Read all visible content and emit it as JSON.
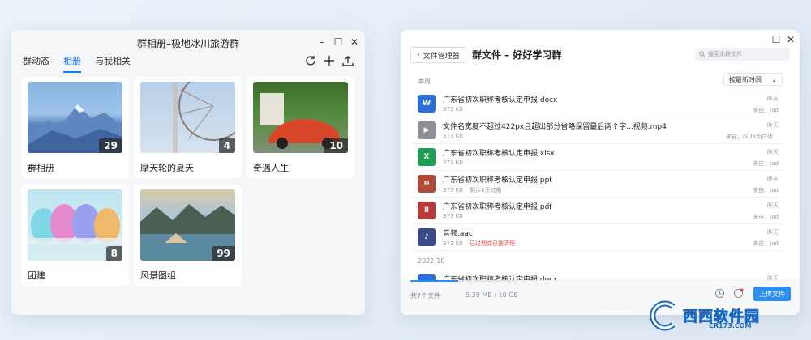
{
  "album_window": {
    "title": "群相册–极地冰川旅游群",
    "controls": {
      "minimize": "–",
      "maximize": "☐",
      "close": "✕"
    },
    "tabs": [
      {
        "label": "群动态",
        "active": false
      },
      {
        "label": "相册",
        "active": true
      },
      {
        "label": "与我相关",
        "active": false
      }
    ],
    "toolbar_icons": [
      "refresh-icon",
      "add-icon",
      "upload-icon"
    ],
    "albums": [
      {
        "name": "群相册",
        "count": "29"
      },
      {
        "name": "摩天轮的夏天",
        "count": "4"
      },
      {
        "name": "奇遇人生",
        "count": "10"
      },
      {
        "name": "团建",
        "count": "8"
      },
      {
        "name": "风景图组",
        "count": "99"
      }
    ]
  },
  "files_window": {
    "back_label": "文件管理器",
    "title": "群文件 – 好好学习群",
    "search_placeholder": "搜索本群文件",
    "controls": {
      "minimize": "–",
      "maximize": "☐",
      "close": "✕"
    },
    "section_this_week": "本周",
    "sort_label": "按最新时间",
    "section_older": "2022-10",
    "files": [
      {
        "icon": "W",
        "name": "广东省初次职称考核认定申报.docx",
        "size": "373 KB",
        "note": "",
        "date": "昨天",
        "sender": "来自：jad",
        "color": "#2b6fd6"
      },
      {
        "icon": "▶",
        "name": "文件名宽度不超过422px且超出部分省略保留最后两个字...视频.mp4",
        "size": "373 KB",
        "note": "",
        "date": "昨天",
        "sender": "来自：ISUX用户体...",
        "color": "#8c9096"
      },
      {
        "icon": "X",
        "name": "广东省初次职称考核认定申报.xlsx",
        "size": "373 KB",
        "note": "",
        "date": "昨天",
        "sender": "来自：jad",
        "color": "#1f9d55"
      },
      {
        "icon": "⊕",
        "name": "广东省初次职称考核认定申报.ppt",
        "size": "373 KB",
        "note": "剩余6天过期",
        "note_red": false,
        "date": "昨天",
        "sender": "来自：jad",
        "color": "#b04a3a"
      },
      {
        "icon": "Ⅱ",
        "name": "广东省初次职称考核认定申报.pdf",
        "size": "373 KB",
        "note": "",
        "date": "昨天",
        "sender": "来自：jad",
        "color": "#b83a3a"
      },
      {
        "icon": "♪",
        "name": "音频.aac",
        "size": "373 KB",
        "note": "已过期或已被清理",
        "note_red": true,
        "date": "昨天",
        "sender": "来自：jad",
        "color": "#3a4a8a"
      }
    ],
    "older_files": [
      {
        "name": "广东省初次职称考核认定申报.docx",
        "date": "昨天",
        "color": "#2b6fd6"
      }
    ],
    "footer": {
      "file_count": "共7个文件",
      "storage": "5.39 MB / 10 GB",
      "storage_fraction": 0.45,
      "upload_label": "上传文件"
    }
  },
  "watermark": {
    "text": "西西软件园",
    "sub": "CR173.COM"
  }
}
